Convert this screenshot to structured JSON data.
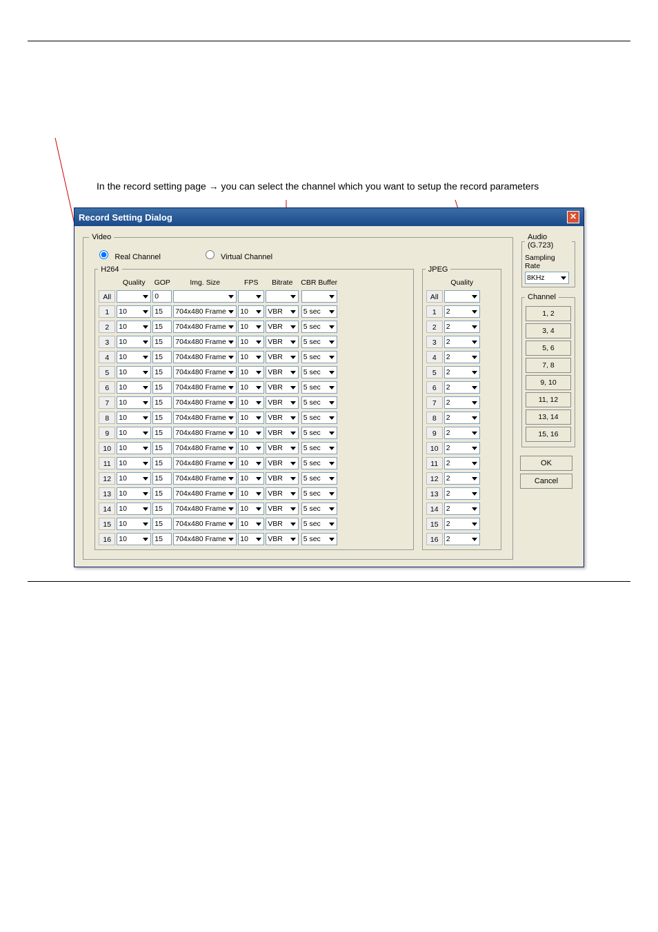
{
  "intro_text": "In the record setting page → you can select the channel which you want to setup the record parameters",
  "dialog": {
    "title": "Record Setting Dialog",
    "video": {
      "legend": "Video",
      "real_channel": "Real Channel",
      "virtual_channel": "Virtual Channel"
    },
    "h264": {
      "legend": "H264",
      "headers": {
        "quality": "Quality",
        "gop": "GOP",
        "imgsize": "Img. Size",
        "fps": "FPS",
        "bitrate": "Bitrate",
        "cbr": "CBR Buffer"
      },
      "all_label": "All",
      "all_row": {
        "quality": "",
        "gop": "0",
        "imgsize": "",
        "fps": "",
        "bitrate": "",
        "cbr": ""
      },
      "rows": [
        {
          "n": "1",
          "quality": "10",
          "gop": "15",
          "imgsize": "704x480 Frame",
          "fps": "10",
          "bitrate": "VBR",
          "cbr": "5 sec"
        },
        {
          "n": "2",
          "quality": "10",
          "gop": "15",
          "imgsize": "704x480 Frame",
          "fps": "10",
          "bitrate": "VBR",
          "cbr": "5 sec"
        },
        {
          "n": "3",
          "quality": "10",
          "gop": "15",
          "imgsize": "704x480 Frame",
          "fps": "10",
          "bitrate": "VBR",
          "cbr": "5 sec"
        },
        {
          "n": "4",
          "quality": "10",
          "gop": "15",
          "imgsize": "704x480 Frame",
          "fps": "10",
          "bitrate": "VBR",
          "cbr": "5 sec"
        },
        {
          "n": "5",
          "quality": "10",
          "gop": "15",
          "imgsize": "704x480 Frame",
          "fps": "10",
          "bitrate": "VBR",
          "cbr": "5 sec"
        },
        {
          "n": "6",
          "quality": "10",
          "gop": "15",
          "imgsize": "704x480 Frame",
          "fps": "10",
          "bitrate": "VBR",
          "cbr": "5 sec"
        },
        {
          "n": "7",
          "quality": "10",
          "gop": "15",
          "imgsize": "704x480 Frame",
          "fps": "10",
          "bitrate": "VBR",
          "cbr": "5 sec"
        },
        {
          "n": "8",
          "quality": "10",
          "gop": "15",
          "imgsize": "704x480 Frame",
          "fps": "10",
          "bitrate": "VBR",
          "cbr": "5 sec"
        },
        {
          "n": "9",
          "quality": "10",
          "gop": "15",
          "imgsize": "704x480 Frame",
          "fps": "10",
          "bitrate": "VBR",
          "cbr": "5 sec"
        },
        {
          "n": "10",
          "quality": "10",
          "gop": "15",
          "imgsize": "704x480 Frame",
          "fps": "10",
          "bitrate": "VBR",
          "cbr": "5 sec"
        },
        {
          "n": "11",
          "quality": "10",
          "gop": "15",
          "imgsize": "704x480 Frame",
          "fps": "10",
          "bitrate": "VBR",
          "cbr": "5 sec"
        },
        {
          "n": "12",
          "quality": "10",
          "gop": "15",
          "imgsize": "704x480 Frame",
          "fps": "10",
          "bitrate": "VBR",
          "cbr": "5 sec"
        },
        {
          "n": "13",
          "quality": "10",
          "gop": "15",
          "imgsize": "704x480 Frame",
          "fps": "10",
          "bitrate": "VBR",
          "cbr": "5 sec"
        },
        {
          "n": "14",
          "quality": "10",
          "gop": "15",
          "imgsize": "704x480 Frame",
          "fps": "10",
          "bitrate": "VBR",
          "cbr": "5 sec"
        },
        {
          "n": "15",
          "quality": "10",
          "gop": "15",
          "imgsize": "704x480 Frame",
          "fps": "10",
          "bitrate": "VBR",
          "cbr": "5 sec"
        },
        {
          "n": "16",
          "quality": "10",
          "gop": "15",
          "imgsize": "704x480 Frame",
          "fps": "10",
          "bitrate": "VBR",
          "cbr": "5 sec"
        }
      ]
    },
    "jpeg": {
      "legend": "JPEG",
      "quality_header": "Quality",
      "all_label": "All",
      "all_value": "",
      "rows": [
        {
          "n": "1",
          "quality": "2"
        },
        {
          "n": "2",
          "quality": "2"
        },
        {
          "n": "3",
          "quality": "2"
        },
        {
          "n": "4",
          "quality": "2"
        },
        {
          "n": "5",
          "quality": "2"
        },
        {
          "n": "6",
          "quality": "2"
        },
        {
          "n": "7",
          "quality": "2"
        },
        {
          "n": "8",
          "quality": "2"
        },
        {
          "n": "9",
          "quality": "2"
        },
        {
          "n": "10",
          "quality": "2"
        },
        {
          "n": "11",
          "quality": "2"
        },
        {
          "n": "12",
          "quality": "2"
        },
        {
          "n": "13",
          "quality": "2"
        },
        {
          "n": "14",
          "quality": "2"
        },
        {
          "n": "15",
          "quality": "2"
        },
        {
          "n": "16",
          "quality": "2"
        }
      ]
    },
    "audio": {
      "legend": "Audio (G.723)",
      "rate_label": "Sampling Rate",
      "rate_value": "8KHz"
    },
    "channel": {
      "legend": "Channel",
      "buttons": [
        "1, 2",
        "3, 4",
        "5, 6",
        "7, 8",
        "9, 10",
        "11, 12",
        "13, 14",
        "15, 16"
      ]
    },
    "ok": "OK",
    "cancel": "Cancel"
  }
}
